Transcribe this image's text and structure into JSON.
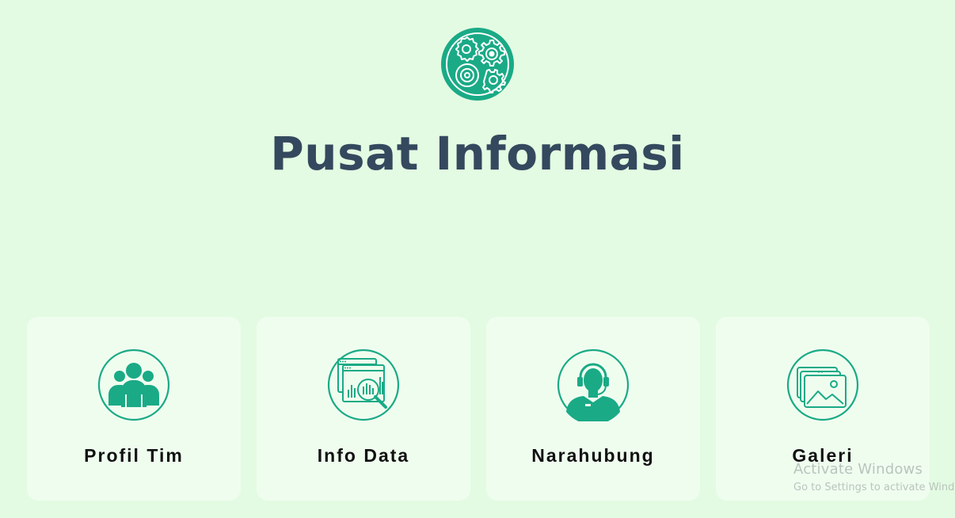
{
  "page": {
    "title": "Pusat Informasi",
    "logo_icon": "gears-icon"
  },
  "colors": {
    "background": "#e3fbe2",
    "card_background": "#effdef",
    "accent": "#1aaa86",
    "title": "#34495e",
    "label": "#111111"
  },
  "menu": {
    "items": [
      {
        "label": "Profil Tim",
        "icon": "team-icon"
      },
      {
        "label": "Info Data",
        "icon": "data-analysis-icon"
      },
      {
        "label": "Narahubung",
        "icon": "headset-contact-icon"
      },
      {
        "label": "Galeri",
        "icon": "gallery-icon"
      }
    ]
  },
  "watermark": {
    "line1": "Activate Windows",
    "line2": "Go to Settings to activate Windows."
  }
}
